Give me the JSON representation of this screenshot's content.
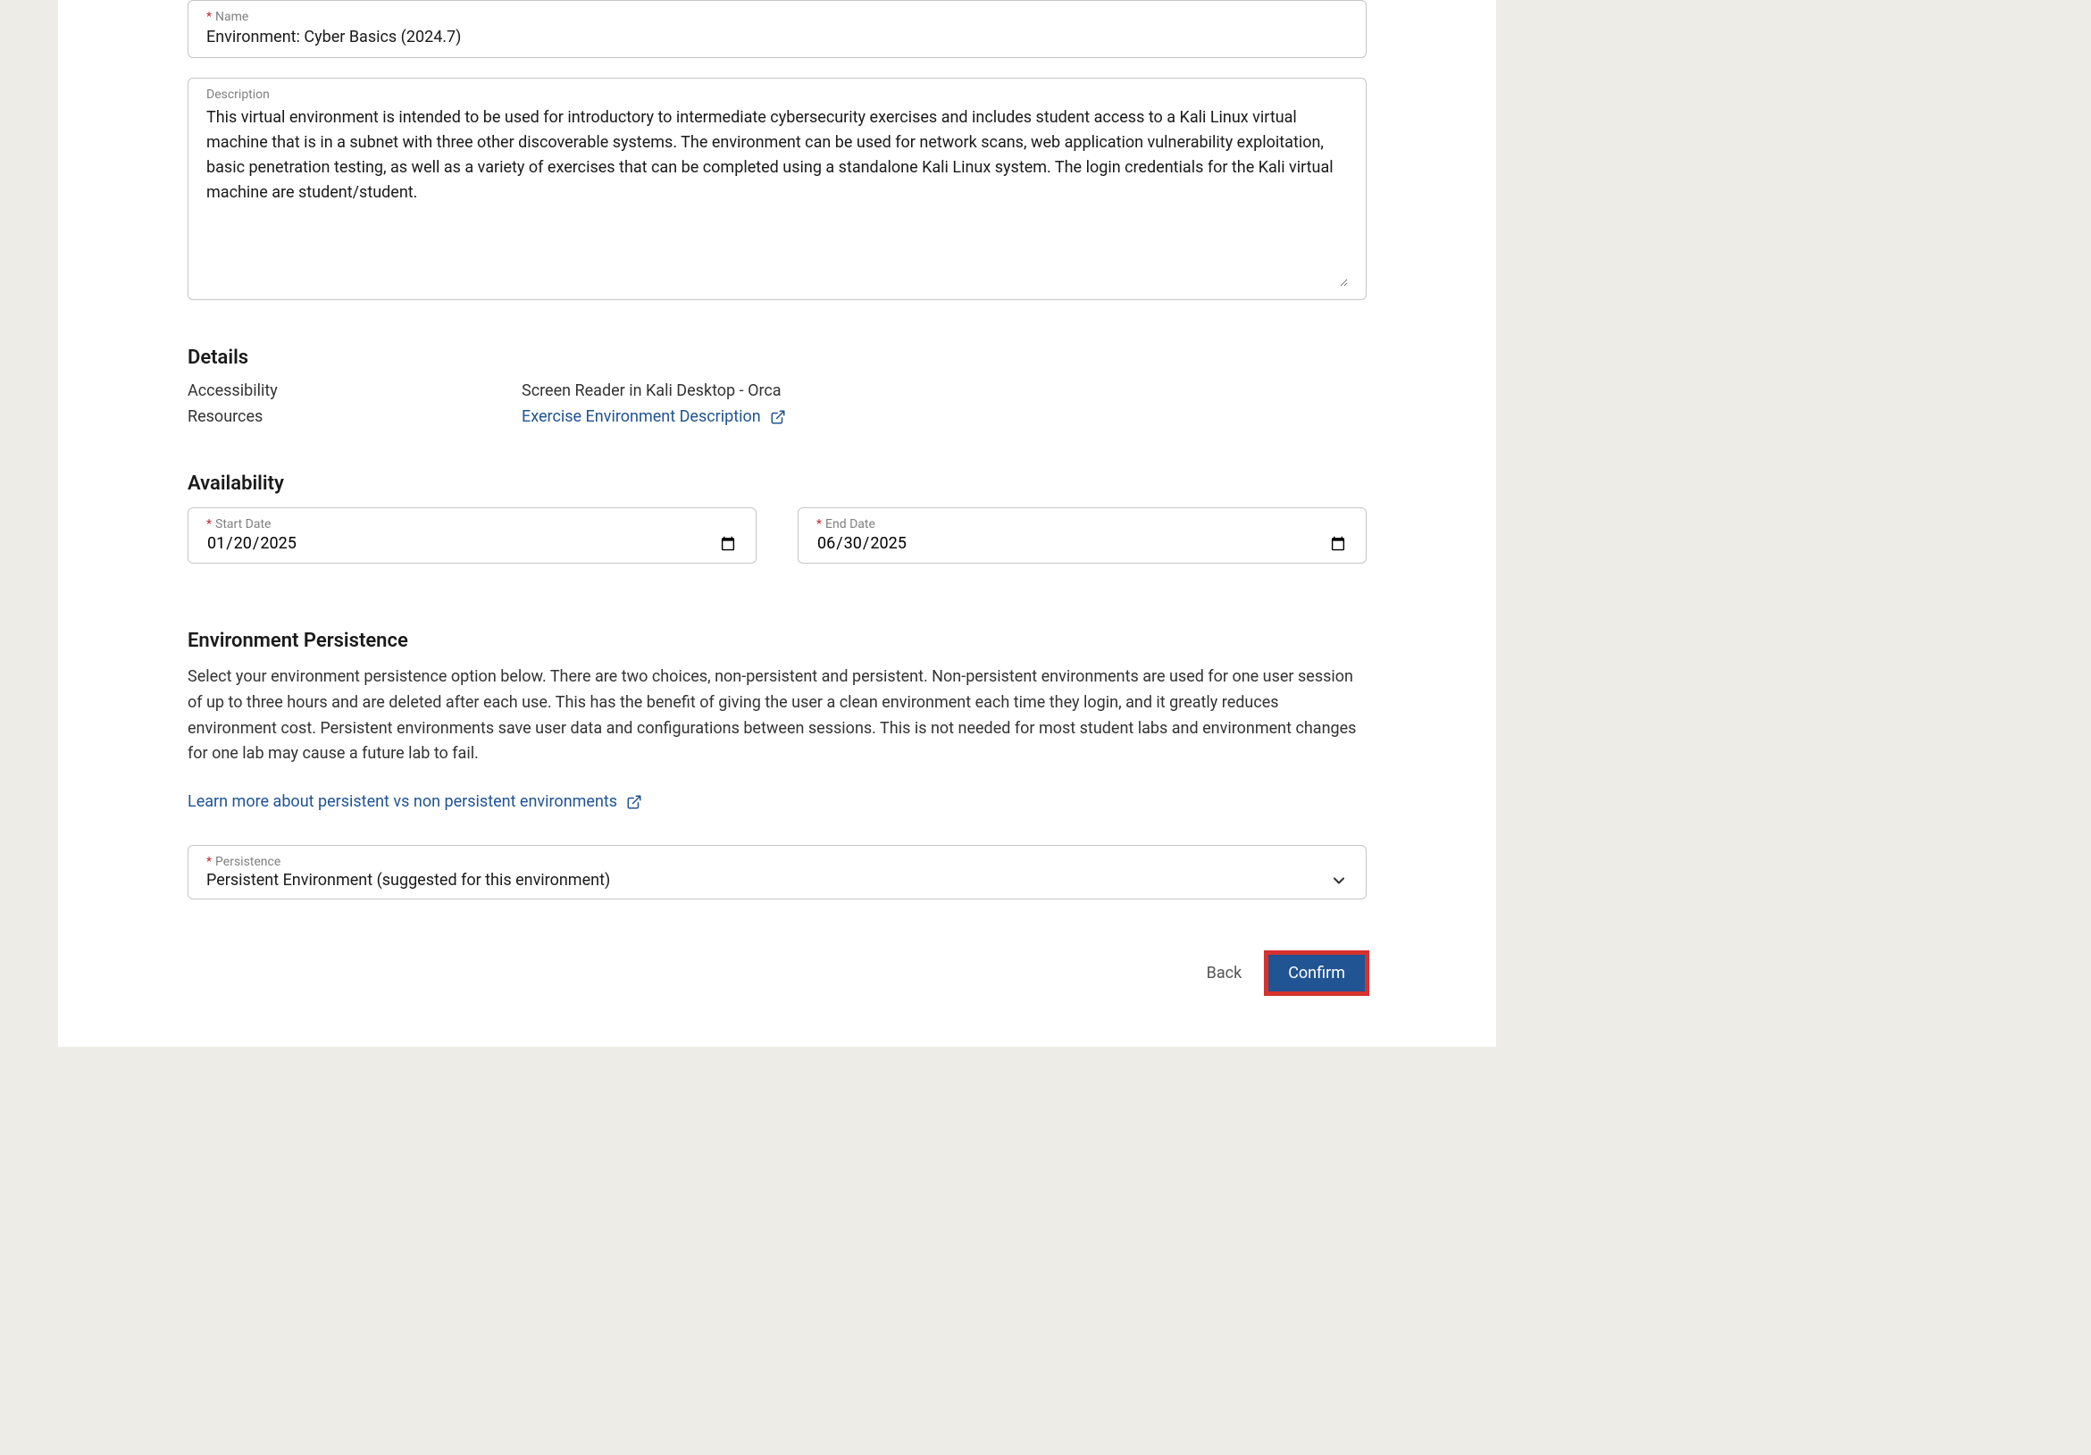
{
  "name_field": {
    "label": "Name",
    "value": "Environment: Cyber Basics (2024.7)"
  },
  "description_field": {
    "label": "Description",
    "value": "This virtual environment is intended to be used for introductory to intermediate cybersecurity exercises and includes student access to a Kali Linux virtual machine that is in a subnet with three other discoverable systems. The environment can be used for network scans, web application vulnerability exploitation, basic penetration testing, as well as a variety of exercises that can be completed using a standalone Kali Linux system. The login credentials for the Kali virtual machine are student/student."
  },
  "details": {
    "title": "Details",
    "accessibility_label": "Accessibility",
    "accessibility_value": "Screen Reader in Kali Desktop - Orca",
    "resources_label": "Resources",
    "resources_link": "Exercise Environment Description"
  },
  "availability": {
    "title": "Availability",
    "start_label": "Start Date",
    "start_value": "2025-01-20",
    "end_label": "End Date",
    "end_value": "2025-06-30"
  },
  "persistence": {
    "title": "Environment Persistence",
    "description": "Select your environment persistence option below. There are two choices, non-persistent and persistent. Non-persistent environments are used for one user session of up to three hours and are deleted after each use. This has the benefit of giving the user a clean environment each time they login, and it greatly reduces environment cost. Persistent environments save user data and configurations between sessions. This is not needed for most student labs and environment changes for one lab may cause a future lab to fail.",
    "learn_more": "Learn more about persistent vs non persistent environments",
    "select_label": "Persistence",
    "select_value": "Persistent Environment (suggested for this environment)"
  },
  "buttons": {
    "back": "Back",
    "confirm": "Confirm"
  }
}
